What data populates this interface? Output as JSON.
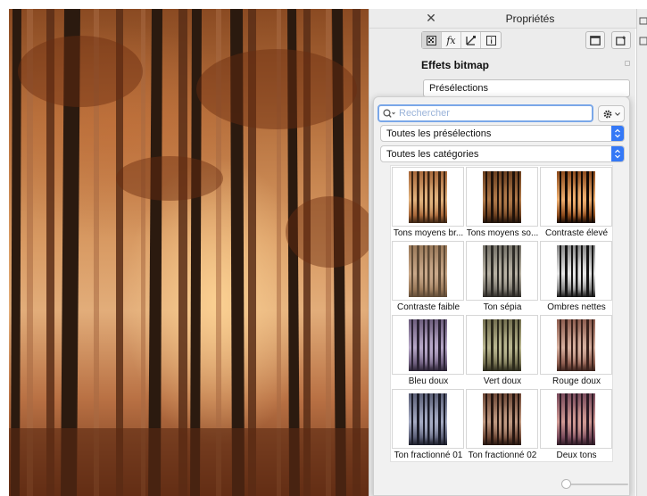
{
  "panel": {
    "title": "Propriétés",
    "section_title": "Effets bitmap",
    "preset_dropdown": "Présélections"
  },
  "popover": {
    "search_placeholder": "Rechercher",
    "presets_filter": "Toutes les présélections",
    "categories_filter": "Toutes les catégories",
    "presets": [
      {
        "label": "Tons moyens br...",
        "tone": "warm-brown"
      },
      {
        "label": "Tons moyens so...",
        "tone": "dark-brown"
      },
      {
        "label": "Contraste élevé",
        "tone": "high-contrast"
      },
      {
        "label": "Contraste faible",
        "tone": "low-contrast"
      },
      {
        "label": "Ton sépia",
        "tone": "sepia-gray"
      },
      {
        "label": "Ombres nettes",
        "tone": "bw"
      },
      {
        "label": "Bleu doux",
        "tone": "soft-blue"
      },
      {
        "label": "Vert doux",
        "tone": "soft-green"
      },
      {
        "label": "Rouge doux",
        "tone": "soft-red"
      },
      {
        "label": "Ton fractionné 01",
        "tone": "split-blue"
      },
      {
        "label": "Ton fractionné 02",
        "tone": "split-brown"
      },
      {
        "label": "Deux tons",
        "tone": "duotone"
      }
    ]
  },
  "colors": {
    "accent": "#3478f6",
    "focus_ring": "#7aa7e8"
  }
}
